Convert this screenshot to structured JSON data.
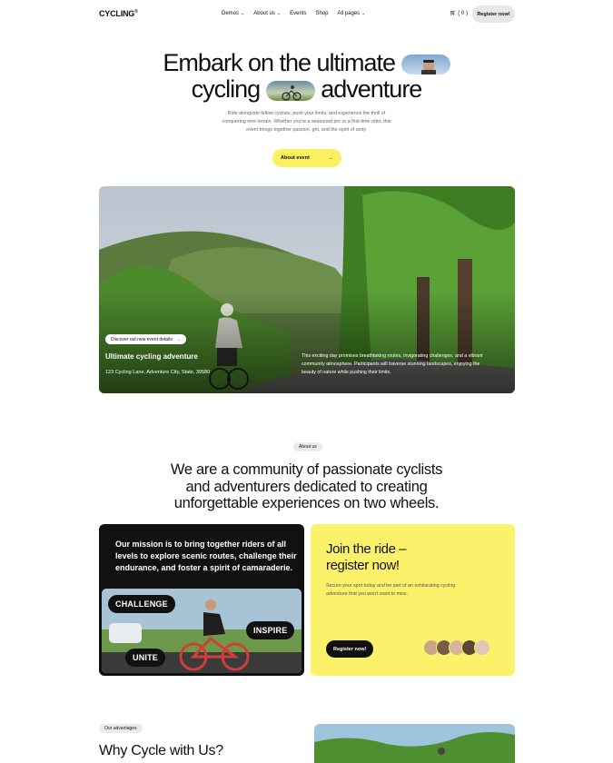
{
  "nav": {
    "logo": "CYCLING",
    "logo_mark": "®",
    "items": [
      {
        "label": "Demos",
        "dropdown": true
      },
      {
        "label": "About us",
        "dropdown": true
      },
      {
        "label": "Events",
        "dropdown": false
      },
      {
        "label": "Shop",
        "dropdown": false
      },
      {
        "label": "All pages",
        "dropdown": true
      }
    ],
    "cart_count": "( 0 )",
    "register_label": "Register now!"
  },
  "hero": {
    "title_line1": "Embark on the ultimate",
    "title_line2_a": "cycling",
    "title_line2_b": "adventure",
    "lead": "Ride alongside fellow cyclists, push your limits, and experience the thrill of conquering new terrain. Whether you're a seasoned pro or a first-time rider, this event brings together passion, grit, and the spirit of unity.",
    "cta_label": "About event",
    "cta_icon": "arrow-right-icon"
  },
  "event_banner": {
    "discover_label": "Discover out new event details",
    "title": "Ultimate cycling adventure",
    "address": "123 Cycling Lane, Adventure City, State, 39580",
    "description": "This exciting day promises breathtaking routes, invigorating challenges, and a vibrant community atmosphere. Participants will traverse stunning landscapes, enjoying the beauty of nature while pushing their limits."
  },
  "about": {
    "tag": "About us",
    "heading": "We are a community of passionate cyclists and adventurers dedicated to creating unforgettable experiences on two wheels.",
    "mission": "Our mission is to bring together riders of all levels to explore scenic routes, challenge their endurance, and foster a spirit of camaraderie.",
    "badges": [
      "CHALLENGE",
      "INSPIRE",
      "UNITE"
    ]
  },
  "join": {
    "title": "Join the ride – register now!",
    "subtitle": "Secure your spot today and be part of an exhilarating cycling adventure that you won't want to miss.",
    "button": "Register now!"
  },
  "advantages": {
    "tag": "Our advantages",
    "heading": "Why Cycle with Us?"
  },
  "colors": {
    "accent_yellow": "#fcf16a",
    "dark": "#111111"
  }
}
